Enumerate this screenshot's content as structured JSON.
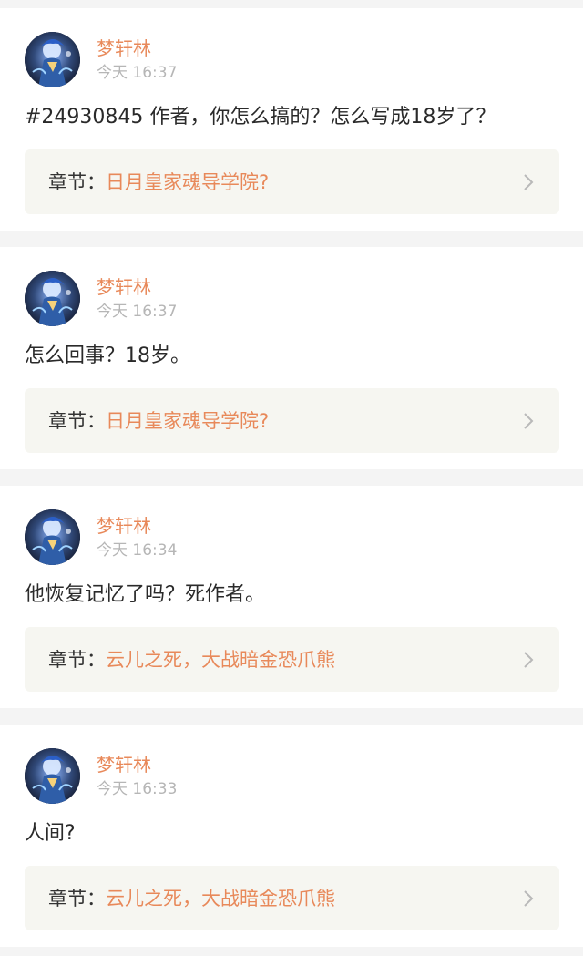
{
  "colors": {
    "accent": "#e8895a",
    "text": "#2a2a2a",
    "muted": "#b6b6b6",
    "chapter_bg": "#f6f6f1",
    "page_bg": "#f4f4f4"
  },
  "comments": [
    {
      "username": "梦轩林",
      "time": "今天 16:37",
      "text": "#24930845 作者，你怎么搞的？怎么写成18岁了？",
      "chapter_prefix": "章节：",
      "chapter_title": "日月皇家魂导学院?",
      "chevron_icon": "chevron-right-icon"
    },
    {
      "username": "梦轩林",
      "time": "今天 16:37",
      "text": "怎么回事？18岁。",
      "chapter_prefix": "章节：",
      "chapter_title": "日月皇家魂导学院?",
      "chevron_icon": "chevron-right-icon"
    },
    {
      "username": "梦轩林",
      "time": "今天 16:34",
      "text": "他恢复记忆了吗？死作者。",
      "chapter_prefix": "章节：",
      "chapter_title": "云儿之死，大战暗金恐爪熊",
      "chevron_icon": "chevron-right-icon"
    },
    {
      "username": "梦轩林",
      "time": "今天 16:33",
      "text": "人间?",
      "chapter_prefix": "章节：",
      "chapter_title": "云儿之死，大战暗金恐爪熊",
      "chevron_icon": "chevron-right-icon"
    }
  ]
}
